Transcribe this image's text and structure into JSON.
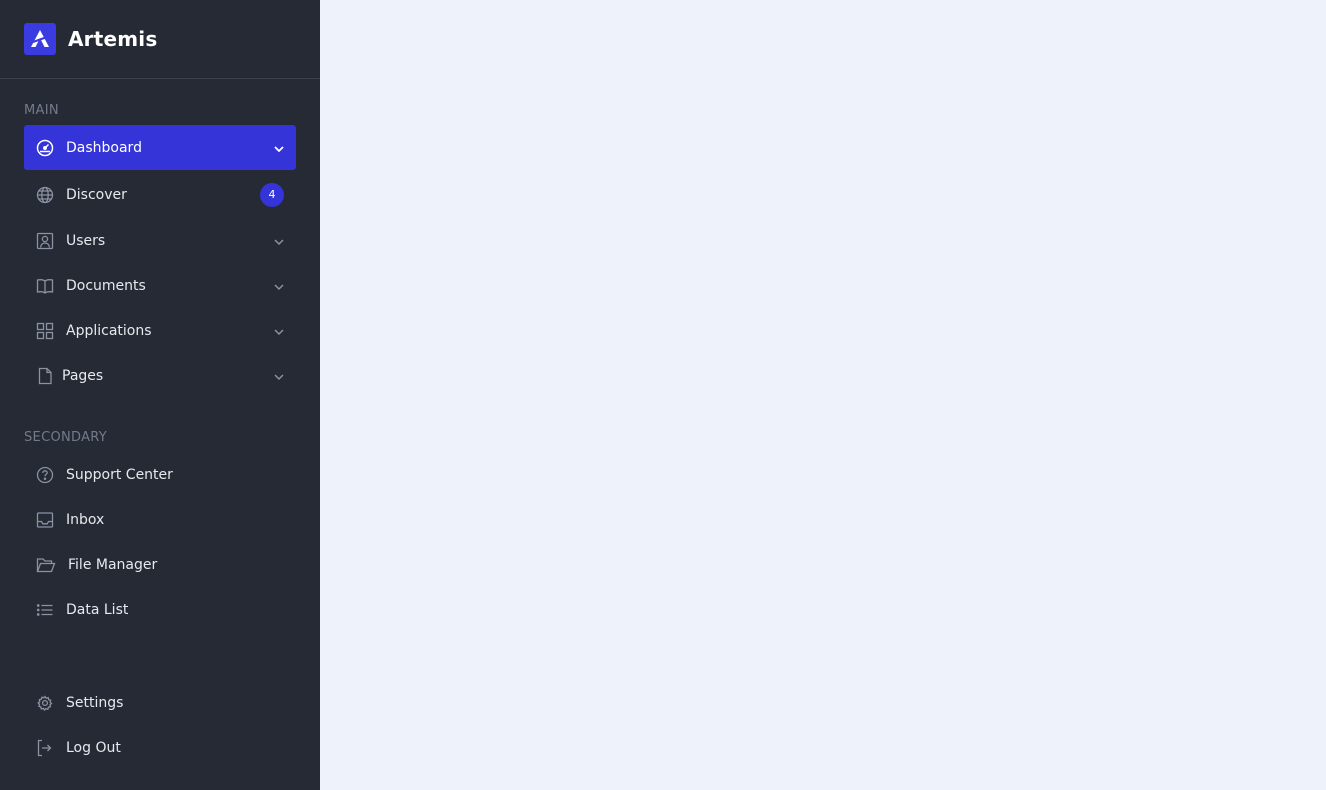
{
  "brand": {
    "name": "Artemis"
  },
  "sections": {
    "main": "MAIN",
    "secondary": "SECONDARY"
  },
  "nav": {
    "dashboard": {
      "label": "Dashboard",
      "icon": "dashboard-gauge-icon"
    },
    "discover": {
      "label": "Discover",
      "badge": "4",
      "icon": "globe-icon"
    },
    "users": {
      "label": "Users",
      "icon": "user-icon"
    },
    "documents": {
      "label": "Documents",
      "icon": "book-icon"
    },
    "applications": {
      "label": "Applications",
      "icon": "grid-icon"
    },
    "pages": {
      "label": "Pages",
      "icon": "file-icon"
    }
  },
  "secondary": {
    "support": {
      "label": "Support Center",
      "icon": "help-circle-icon"
    },
    "inbox": {
      "label": "Inbox",
      "icon": "inbox-icon"
    },
    "files": {
      "label": "File Manager",
      "icon": "folder-open-icon"
    },
    "datalist": {
      "label": "Data List",
      "icon": "list-icon"
    }
  },
  "footer": {
    "settings": {
      "label": "Settings",
      "icon": "gear-icon"
    },
    "logout": {
      "label": "Log Out",
      "icon": "logout-icon"
    }
  },
  "colors": {
    "sidebar_bg": "#252a34",
    "accent": "#3434d8",
    "main_bg": "#eef2fb"
  }
}
